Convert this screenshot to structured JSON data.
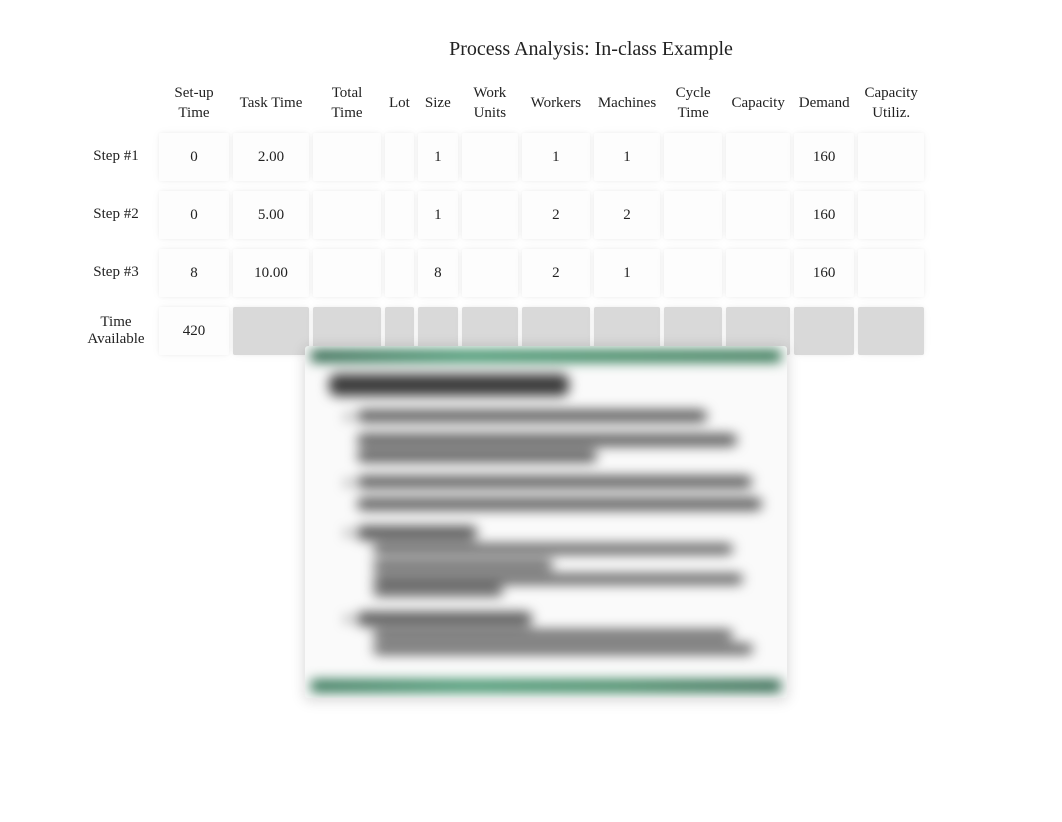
{
  "title": "Process Analysis: In-class Example",
  "headers": {
    "setup": "Set-up Time",
    "task": "Task Time",
    "total": "Total Time",
    "lot": "Lot",
    "size": "Size",
    "work": "Work Units",
    "workers": "Workers",
    "machines": "Machines",
    "cycle": "Cycle Time",
    "capacity": "Capacity",
    "demand": "Demand",
    "util": "Capacity Utiliz."
  },
  "rows": {
    "step1": {
      "label": "Step #1",
      "setup": "0",
      "task": "2.00",
      "total": "",
      "lot": "",
      "size": "1",
      "work": "",
      "workers": "1",
      "machines": "1",
      "cycle": "",
      "capacity": "",
      "demand": "160",
      "util": ""
    },
    "step2": {
      "label": "Step #2",
      "setup": "0",
      "task": "5.00",
      "total": "",
      "lot": "",
      "size": "1",
      "work": "",
      "workers": "2",
      "machines": "2",
      "cycle": "",
      "capacity": "",
      "demand": "160",
      "util": ""
    },
    "step3": {
      "label": "Step #3",
      "setup": "8",
      "task": "10.00",
      "total": "",
      "lot": "",
      "size": "8",
      "work": "",
      "workers": "2",
      "machines": "1",
      "cycle": "",
      "capacity": "",
      "demand": "160",
      "util": ""
    },
    "time": {
      "label": "Time Available",
      "setup": "420",
      "task": "",
      "total": "",
      "lot": "",
      "size": "",
      "work": "",
      "workers": "",
      "machines": "",
      "cycle": "",
      "capacity": "",
      "demand": "",
      "util": ""
    }
  }
}
